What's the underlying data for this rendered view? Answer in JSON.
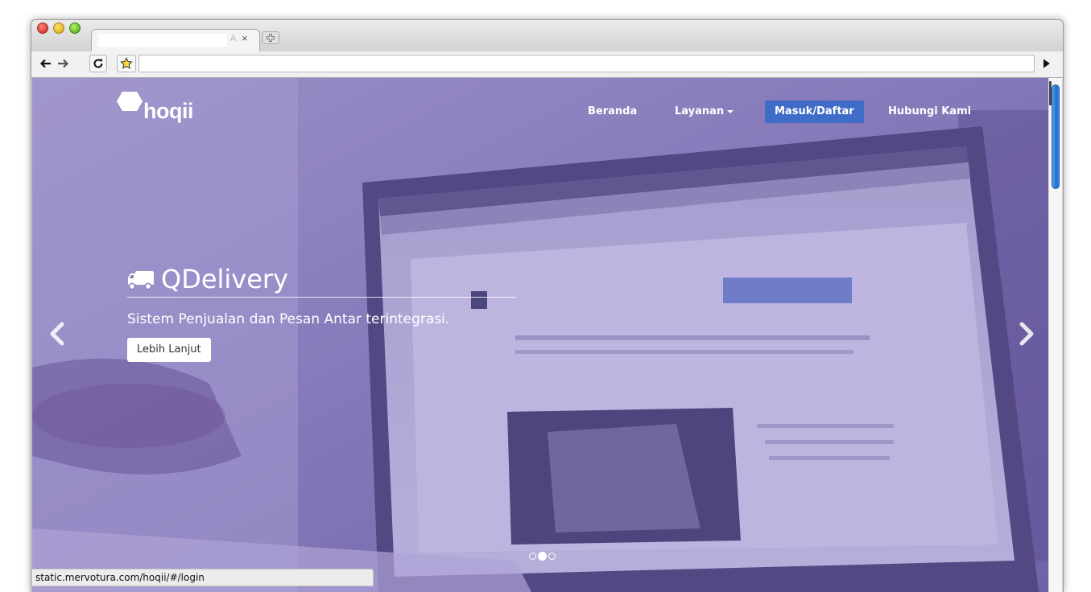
{
  "browser": {
    "tab_close": "×",
    "tab_fade": "A",
    "new_tab_icon": "plus-tab-icon",
    "back_icon": "arrow-left-icon",
    "forward_icon": "arrow-right-icon",
    "reload_icon": "reload-icon",
    "bookmark_icon": "star-icon",
    "menu_icon": "menu-play-icon",
    "status_url": "static.mervotura.com/hoqii/#/login"
  },
  "site": {
    "logo_text": "hoqii",
    "nav": [
      {
        "label": "Beranda"
      },
      {
        "label": "Layanan"
      },
      {
        "label": "Masuk/Daftar"
      },
      {
        "label": "Hubungi Kami"
      }
    ],
    "carousel": {
      "title": "QDelivery",
      "subtitle": "Sistem Penjualan dan Pesan Antar terintegrasi.",
      "button_label": "Lebih Lanjut",
      "slide_count": 3,
      "active_slide": 2
    }
  },
  "colors": {
    "overlay": "#7462be",
    "nav_active": "#3f6cc6",
    "scroll_thumb": "#1f6fd0"
  }
}
